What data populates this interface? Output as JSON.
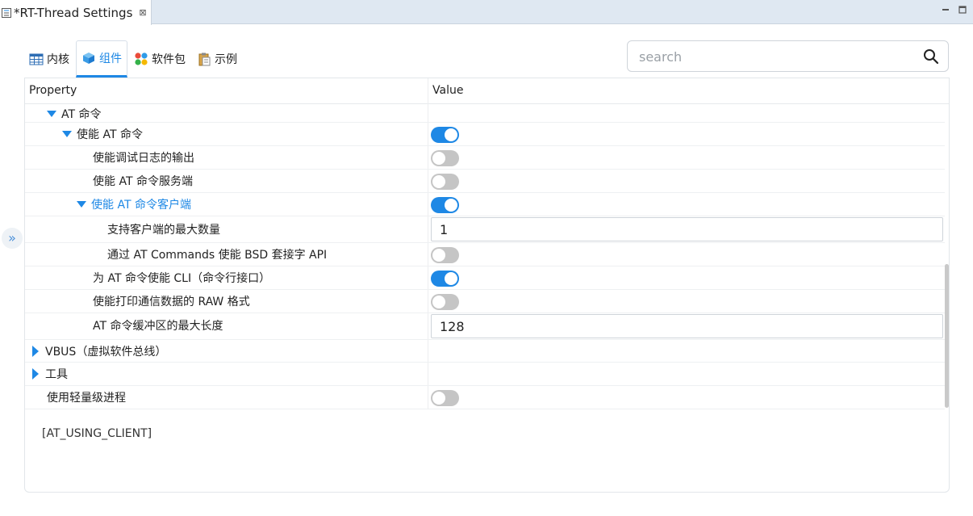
{
  "editor": {
    "tab_title": "*RT-Thread Settings",
    "close_glyph": "⊠"
  },
  "category_tabs": [
    {
      "label": "内核",
      "icon": "table-icon",
      "active": false
    },
    {
      "label": "组件",
      "icon": "component-cube-icon",
      "active": true
    },
    {
      "label": "软件包",
      "icon": "packages-icon",
      "active": false
    },
    {
      "label": "示例",
      "icon": "clipboard-icon",
      "active": false
    }
  ],
  "search": {
    "placeholder": "search",
    "value": ""
  },
  "table": {
    "header_property": "Property",
    "header_value": "Value",
    "rows": [
      {
        "label": "AT 命令",
        "expander": "down",
        "value_type": "none"
      },
      {
        "label": "使能 AT 命令",
        "expander": "down",
        "value_type": "toggle",
        "value": true
      },
      {
        "label": "使能调试日志的输出",
        "expander": "none",
        "value_type": "toggle",
        "value": false
      },
      {
        "label": "使能 AT 命令服务端",
        "expander": "none",
        "value_type": "toggle",
        "value": false
      },
      {
        "label": "使能 AT 命令客户端",
        "expander": "down",
        "value_type": "toggle",
        "value": true,
        "selected": true
      },
      {
        "label": "支持客户端的最大数量",
        "expander": "none",
        "value_type": "text",
        "value": "1"
      },
      {
        "label": "通过 AT Commands 使能 BSD 套接字 API",
        "expander": "none",
        "value_type": "toggle",
        "value": false
      },
      {
        "label": "为 AT 命令使能 CLI（命令行接口）",
        "expander": "none",
        "value_type": "toggle",
        "value": true
      },
      {
        "label": "使能打印通信数据的 RAW 格式",
        "expander": "none",
        "value_type": "toggle",
        "value": false
      },
      {
        "label": "AT 命令缓冲区的最大长度",
        "expander": "none",
        "value_type": "text",
        "value": "128"
      },
      {
        "label": "VBUS（虚拟软件总线）",
        "expander": "right",
        "value_type": "none"
      },
      {
        "label": "工具",
        "expander": "right",
        "value_type": "none"
      },
      {
        "label": "使用轻量级进程",
        "expander": "none",
        "value_type": "toggle",
        "value": false
      }
    ]
  },
  "description": "[AT_USING_CLIENT]",
  "side_expand_glyph": "»",
  "colors": {
    "accent": "#1e88e5",
    "toggle_off": "#c5c5c5"
  }
}
